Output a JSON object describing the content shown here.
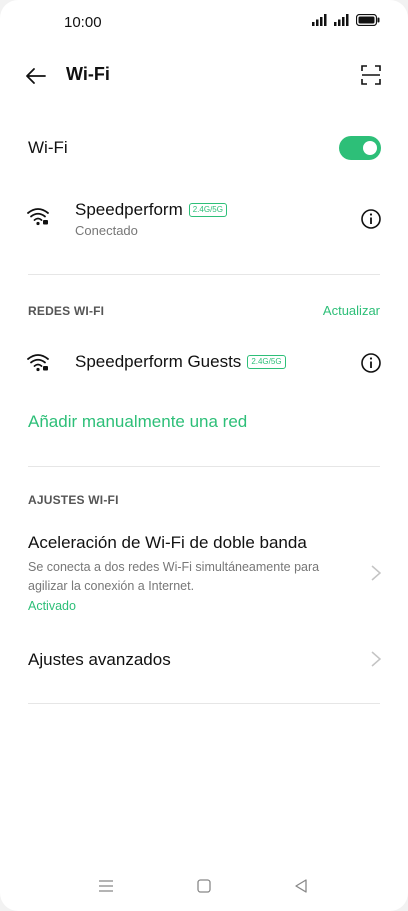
{
  "status_bar": {
    "time": "10:00"
  },
  "header": {
    "title": "Wi-Fi",
    "icons": {
      "back": "arrow-left-icon",
      "scan": "qr-scan-icon"
    }
  },
  "wifi_toggle": {
    "label": "Wi-Fi",
    "enabled": true
  },
  "connected_network": {
    "name": "Speedperform",
    "band": "2.4G/5G",
    "status": "Conectado"
  },
  "networks_section": {
    "header": "REDES WI-FI",
    "refresh_label": "Actualizar",
    "networks": [
      {
        "name": "Speedperform Guests",
        "band": "2.4G/5G"
      }
    ],
    "add_network_label": "Añadir manualmente una red"
  },
  "settings_section": {
    "header": "AJUSTES WI-FI",
    "dual_band": {
      "title": "Aceleración de Wi-Fi de doble banda",
      "description": "Se conecta a dos redes Wi-Fi simultáneamente para agilizar la conexión a Internet.",
      "status": "Activado"
    },
    "advanced": {
      "title": "Ajustes avanzados"
    }
  },
  "colors": {
    "accent": "#2dbf78",
    "text_primary": "#111111",
    "text_secondary": "#777777",
    "divider": "#e6e6e6"
  }
}
